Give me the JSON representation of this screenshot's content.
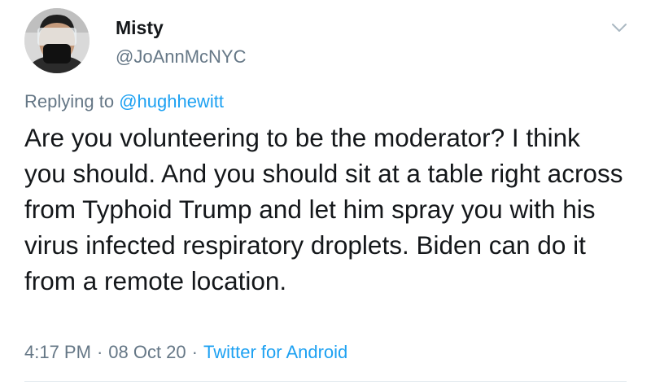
{
  "tweet": {
    "display_name": "Misty",
    "handle": "@JoAnnMcNYC",
    "replying_prefix": "Replying to ",
    "replying_to": "@hughhewitt",
    "text": "Are you volunteering to be the moderator? I think you should. And you should sit at a table right across from Typhoid Trump and let him spray you with his virus infected respiratory droplets. Biden can do it from a remote location.",
    "time": "4:17 PM",
    "separator": "·",
    "date": "08 Oct 20",
    "source": "Twitter for Android"
  },
  "icons": {
    "avatar": "profile-photo-masked-person",
    "menu": "chevron-down-icon"
  },
  "colors": {
    "primary_text": "#14171a",
    "secondary_text": "#657786",
    "link": "#1da1f2",
    "divider": "#e1e8ed"
  }
}
